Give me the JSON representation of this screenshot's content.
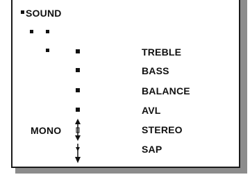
{
  "menu": {
    "title": "SOUND",
    "items": [
      {
        "label": "TREBLE"
      },
      {
        "label": "BASS"
      },
      {
        "label": "BALANCE"
      },
      {
        "label": "AVL"
      },
      {
        "label": "STEREO"
      },
      {
        "label": "SAP"
      }
    ],
    "current_value": "MONO"
  },
  "icons": {
    "item_marker": "square-bullet-icon",
    "value_selector": "up-down-arrow-icon"
  },
  "colors": {
    "text": "#111111",
    "shadow": "#8c8c8c",
    "background": "#ffffff"
  }
}
